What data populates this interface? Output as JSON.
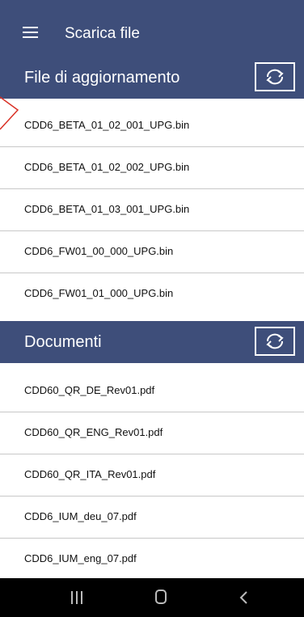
{
  "appbar": {
    "title": "Scarica file",
    "menu_icon": "hamburger-menu-icon"
  },
  "updates": {
    "header": "File di aggiornamento",
    "refresh_icon": "refresh-icon",
    "items": [
      {
        "label": "CDD6_BETA_01_02_001_UPG.bin"
      },
      {
        "label": "CDD6_BETA_01_02_002_UPG.bin"
      },
      {
        "label": "CDD6_BETA_01_03_001_UPG.bin"
      },
      {
        "label": "CDD6_FW01_00_000_UPG.bin"
      },
      {
        "label": "CDD6_FW01_01_000_UPG.bin"
      }
    ]
  },
  "documents": {
    "header": "Documenti",
    "refresh_icon": "refresh-icon",
    "items": [
      {
        "label": "CDD60_QR_DE_Rev01.pdf"
      },
      {
        "label": "CDD60_QR_ENG_Rev01.pdf"
      },
      {
        "label": "CDD60_QR_ITA_Rev01.pdf"
      },
      {
        "label": "CDD6_IUM_deu_07.pdf"
      },
      {
        "label": "CDD6_IUM_eng_07.pdf"
      }
    ]
  },
  "navbar": {
    "icons": [
      "recent-apps-icon",
      "home-icon",
      "back-icon"
    ]
  },
  "colors": {
    "primary": "#3e4e7a",
    "annotation": "#d93025",
    "navbar": "#000000"
  }
}
